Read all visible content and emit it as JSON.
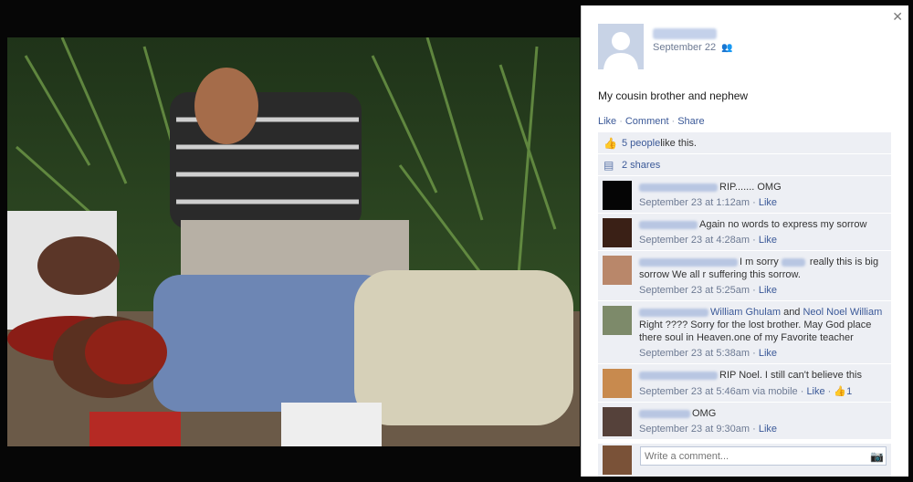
{
  "post": {
    "date": "September 22",
    "text": "My cousin brother and nephew",
    "actions": {
      "like": "Like",
      "comment": "Comment",
      "share": "Share"
    }
  },
  "ufi": {
    "likes_link": "5 people",
    "likes_suffix": " like this.",
    "shares": "2 shares"
  },
  "comments": [
    {
      "text": "RIP....... OMG",
      "time": "September 23 at 1:12am",
      "like": "Like"
    },
    {
      "text": "Again no words to express my sorrow",
      "time": "September 23 at 4:28am",
      "like": "Like"
    },
    {
      "text_a": "I m sorry",
      "text_b": "really this is big sorrow We all r suffering this sorrow.",
      "time": "September 23 at 5:25am",
      "like": "Like"
    },
    {
      "tag_1": "William Ghulam",
      "and": " and ",
      "tag_2": "Neol Noel William",
      "text": " Right ???? Sorry for the lost brother. May God place there soul in Heaven.one of my Favorite teacher",
      "time": "September 23 at 5:38am",
      "like": "Like"
    },
    {
      "text": "RIP Noel. I still can't believe this",
      "time": "September 23 at 5:46am via mobile",
      "like": "Like",
      "like_count": "1"
    },
    {
      "text": "OMG",
      "time": "September 23 at 9:30am",
      "like": "Like"
    }
  ],
  "composer": {
    "placeholder": "Write a comment..."
  },
  "icons": {
    "close": "close-icon",
    "friends": "friends-audience-icon",
    "thumb": "thumbs-up-icon",
    "share": "share-icon",
    "camera": "camera-icon"
  }
}
